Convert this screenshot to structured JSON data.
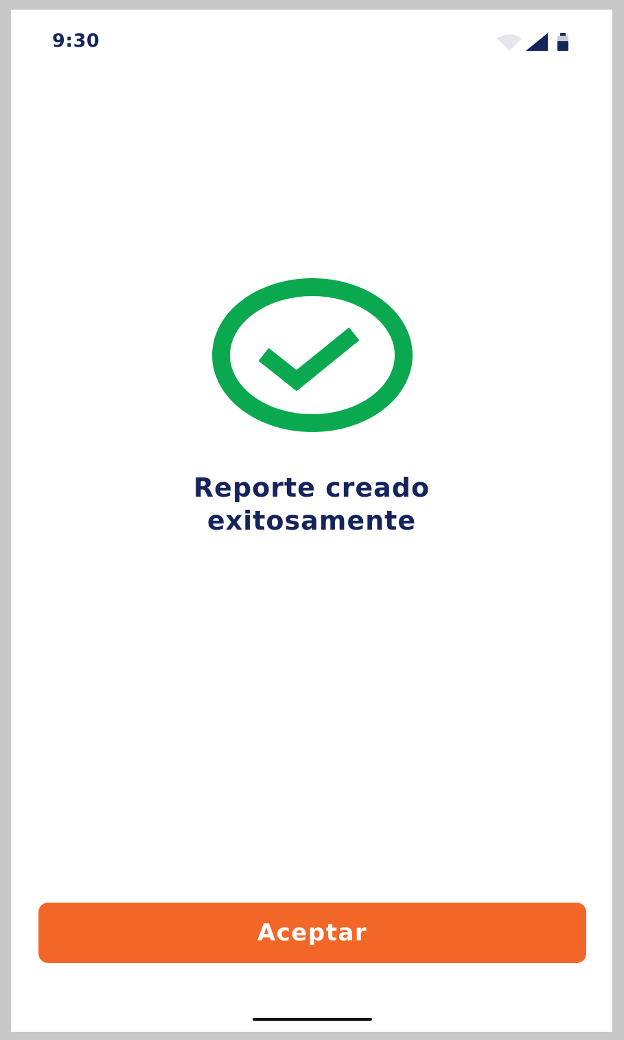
{
  "status_bar": {
    "time": "9:30",
    "icons": [
      "wifi-icon",
      "cellular-signal-icon",
      "battery-icon"
    ]
  },
  "success": {
    "icon": "check-circle-icon",
    "message_line1": "Reporte creado",
    "message_line2": "exitosamente"
  },
  "actions": {
    "accept_label": "Aceptar"
  },
  "colors": {
    "accent": "#f26727",
    "success": "#0aa84f",
    "text_primary": "#16245c",
    "background": "#ffffff"
  }
}
